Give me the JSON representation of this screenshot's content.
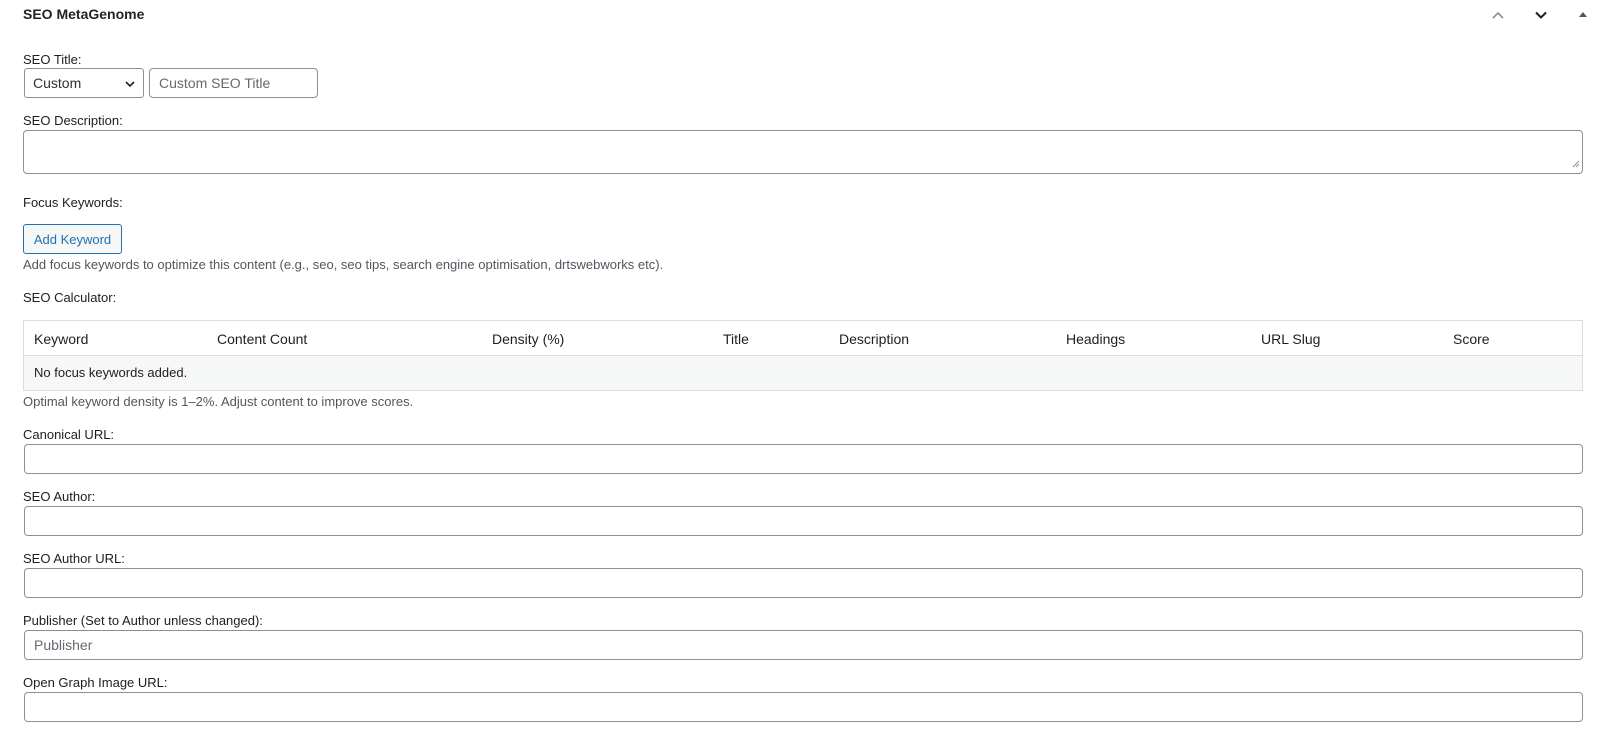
{
  "panel": {
    "title": "SEO MetaGenome",
    "controls": [
      "move-up-icon",
      "move-down-icon",
      "toggle-panel-icon"
    ]
  },
  "seo_title": {
    "label": "SEO Title:",
    "select_value": "Custom",
    "input_placeholder": "Custom SEO Title"
  },
  "seo_description": {
    "label": "SEO Description:",
    "value": ""
  },
  "focus_keywords": {
    "label": "Focus Keywords:",
    "add_button": "Add Keyword",
    "help": "Add focus keywords to optimize this content (e.g., seo, seo tips, search engine optimisation, drtswebworks etc)."
  },
  "calculator": {
    "label": "SEO Calculator:",
    "columns": [
      "Keyword",
      "Content Count",
      "Density (%)",
      "Title",
      "Description",
      "Headings",
      "URL Slug",
      "Score"
    ],
    "empty_message": "No focus keywords added.",
    "note": "Optimal keyword density is 1–2%. Adjust content to improve scores."
  },
  "canonical_url": {
    "label": "Canonical URL:",
    "value": ""
  },
  "seo_author": {
    "label": "SEO Author:",
    "value": ""
  },
  "seo_author_url": {
    "label": "SEO Author URL:",
    "value": ""
  },
  "publisher": {
    "label": "Publisher (Set to Author unless changed):",
    "placeholder": "Publisher"
  },
  "og_image_url": {
    "label": "Open Graph Image URL:",
    "value": ""
  },
  "colors": {
    "accent": "#2271b1",
    "border": "#8c8f94",
    "row_bg": "#f6f7f7"
  }
}
